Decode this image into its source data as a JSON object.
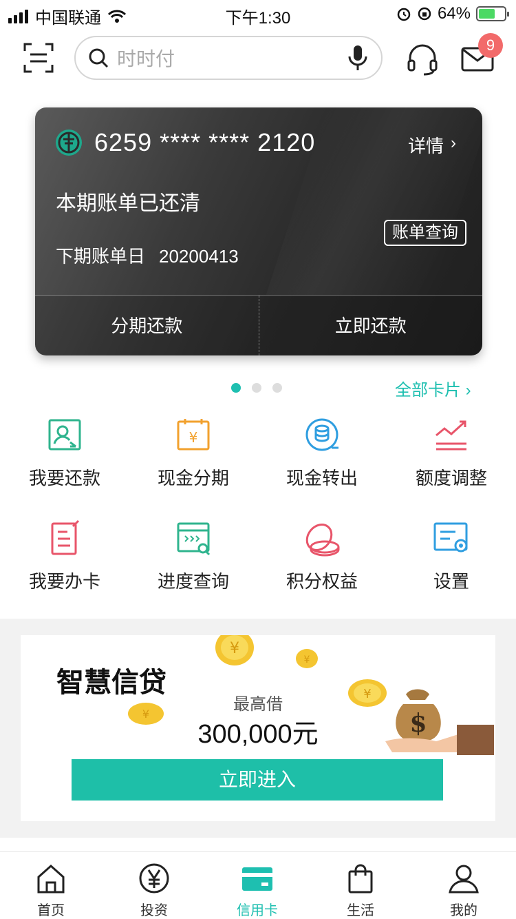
{
  "status_bar": {
    "carrier": "中国联通",
    "time": "下午1:30",
    "battery": "64%",
    "battery_level": 0.64
  },
  "search": {
    "placeholder": "时时付"
  },
  "messages": {
    "badge": "9"
  },
  "card": {
    "number": "6259 **** **** 2120",
    "detail_label": "详情",
    "status": "本期账单已还清",
    "bill_query": "账单查询",
    "next_bill_label": "下期账单日",
    "next_bill_date": "20200413",
    "action_installment": "分期还款",
    "action_repay": "立即还款"
  },
  "pager": {
    "count": 3,
    "active": 0,
    "all_cards": "全部卡片"
  },
  "grid": [
    {
      "label": "我要还款",
      "icon": "repay-icon",
      "color": "#2fb48e"
    },
    {
      "label": "现金分期",
      "icon": "cash-installment-icon",
      "color": "#f2a12e"
    },
    {
      "label": "现金转出",
      "icon": "cash-transfer-icon",
      "color": "#2f9ee0"
    },
    {
      "label": "额度调整",
      "icon": "limit-adjust-icon",
      "color": "#e8556a"
    },
    {
      "label": "我要办卡",
      "icon": "apply-card-icon",
      "color": "#e8556a"
    },
    {
      "label": "进度查询",
      "icon": "progress-query-icon",
      "color": "#2fb48e"
    },
    {
      "label": "积分权益",
      "icon": "points-icon",
      "color": "#e8556a"
    },
    {
      "label": "设置",
      "icon": "settings-icon",
      "color": "#2f9ee0"
    }
  ],
  "promo": {
    "title": "智慧信贷",
    "subtitle": "最高借",
    "amount": "300,000元",
    "cta": "立即进入"
  },
  "tabs": [
    {
      "label": "首页",
      "icon": "home-icon"
    },
    {
      "label": "投资",
      "icon": "yen-icon"
    },
    {
      "label": "信用卡",
      "icon": "credit-card-icon"
    },
    {
      "label": "生活",
      "icon": "shopping-bag-icon"
    },
    {
      "label": "我的",
      "icon": "user-icon"
    }
  ],
  "colors": {
    "accent": "#1ebfb0",
    "badge": "#f26a6a"
  }
}
